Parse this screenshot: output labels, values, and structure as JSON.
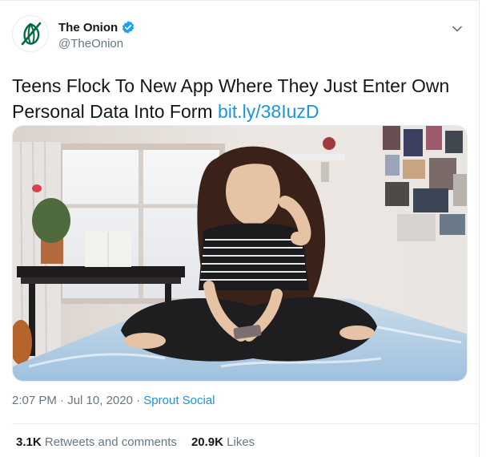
{
  "account": {
    "display_name": "The Onion",
    "handle": "@TheOnion",
    "verified": true,
    "avatar_icon": "onion-logo-icon",
    "brand_color": "#006b3f"
  },
  "tweet": {
    "text": "Teens Flock To New App Where They Just Enter Own Personal Data Into Form",
    "link": "bit.ly/38IuzD",
    "image_alt": "Teenage girl sitting cross-legged on a bed looking at her phone"
  },
  "meta": {
    "time": "2:07 PM",
    "separator": "·",
    "date": "Jul 10, 2020",
    "source": "Sprout Social"
  },
  "stats": {
    "retweets_count": "3.1K",
    "retweets_label": "Retweets and comments",
    "likes_count": "20.9K",
    "likes_label": "Likes"
  },
  "colors": {
    "link": "#1b95e0",
    "secondary_text": "#657786",
    "verified_badge": "#1da1f2"
  }
}
